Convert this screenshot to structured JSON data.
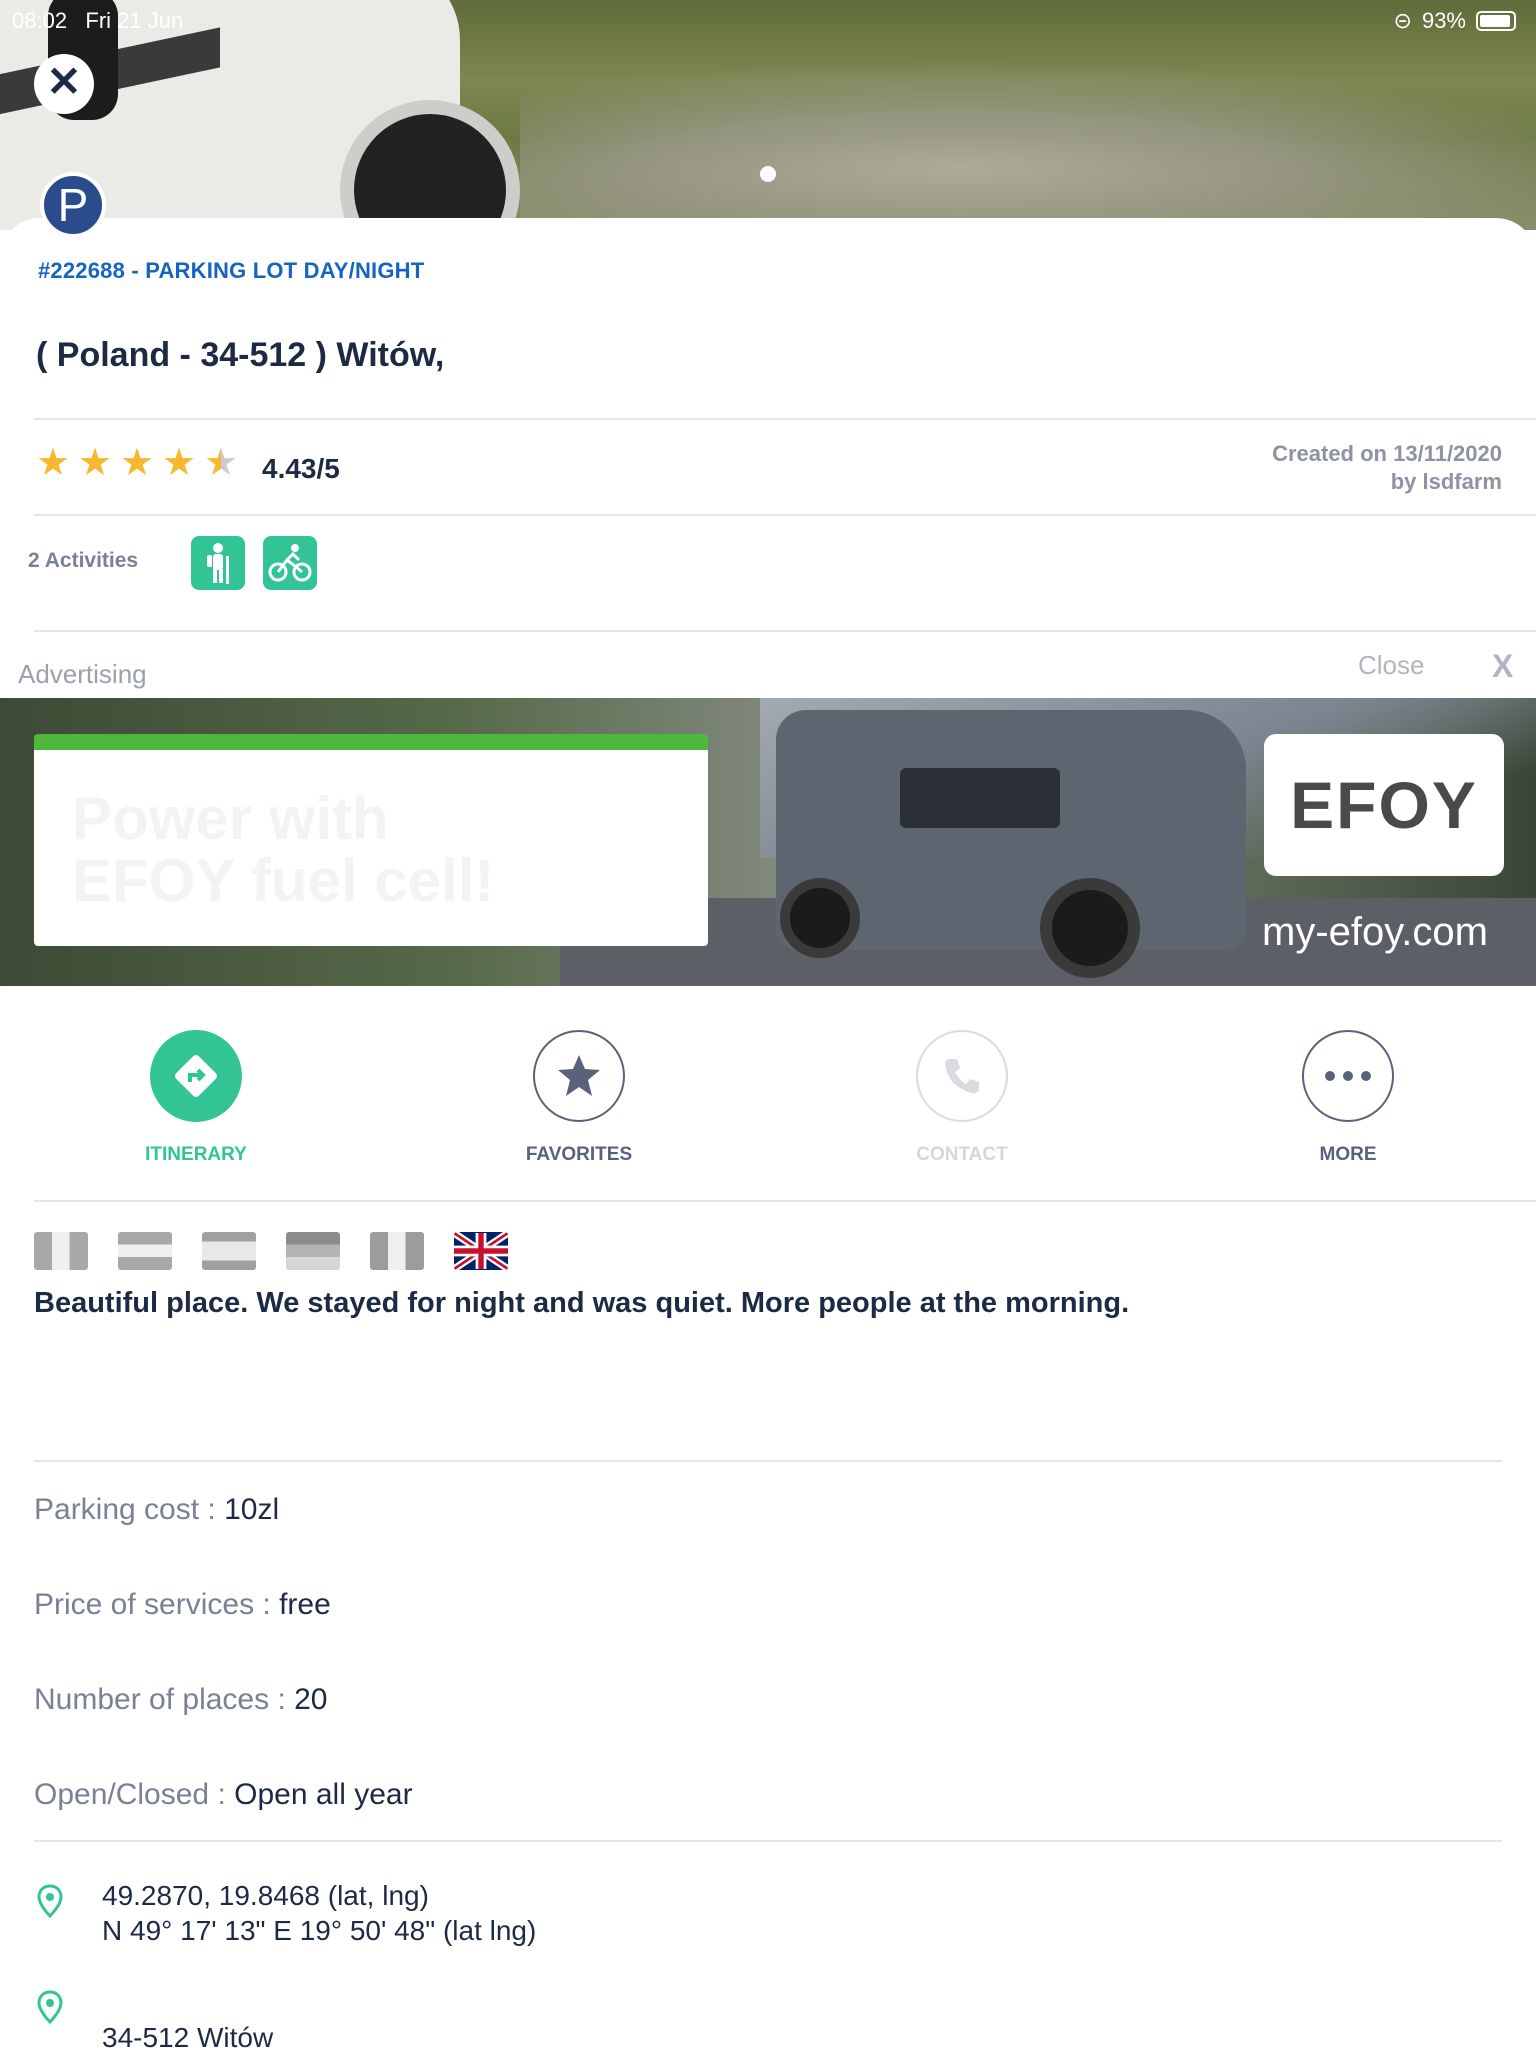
{
  "status_bar": {
    "time": "08:02",
    "date": "Fri 21 Jun",
    "battery": "93%"
  },
  "place": {
    "reference": "#222688 - PARKING LOT DAY/NIGHT",
    "title": "( Poland - 34-512 ) Witów,",
    "badge_letter": "P",
    "rating_value": 4.43,
    "rating_text": "4.43/5",
    "created_line1": "Created on 13/11/2020",
    "created_line2": "by lsdfarm"
  },
  "activities": {
    "label": "2 Activities",
    "icons": [
      "hiking-icon",
      "cycling-icon"
    ]
  },
  "advertising": {
    "label": "Advertising",
    "close_label": "Close",
    "close_x": "X",
    "panel_line1": "Power with",
    "panel_line2": "EFOY fuel cell!",
    "logo": "EFOY",
    "url": "my-efoy.com"
  },
  "actions": [
    {
      "label": "ITINERARY",
      "icon": "itinerary-icon"
    },
    {
      "label": "FAVORITES",
      "icon": "star-icon"
    },
    {
      "label": "CONTACT",
      "icon": "phone-icon"
    },
    {
      "label": "MORE",
      "icon": "more-icon"
    }
  ],
  "review": {
    "text": "Beautiful place. We stayed for night and was quiet. More people at the morning."
  },
  "details": {
    "parking_cost_label": "Parking cost : ",
    "parking_cost": "10zl",
    "price_services_label": "Price of services : ",
    "price_services": "free",
    "places_label": "Number of places : ",
    "places": "20",
    "open_label": "Open/Closed : ",
    "open": "Open all year"
  },
  "location": {
    "decimal": "49.2870, 19.8468 (lat, lng)",
    "dms": "N 49° 17' 13\" E 19° 50' 48\" (lat lng)",
    "address": "34-512 Witów"
  },
  "colors": {
    "accent_green": "#33c496",
    "link_blue": "#1565c0",
    "star": "#f5b82e",
    "efoy_green": "#4fb83c"
  }
}
